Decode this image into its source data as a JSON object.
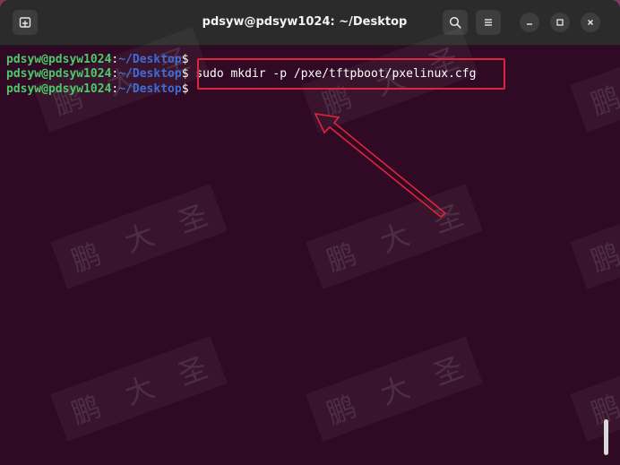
{
  "window": {
    "title": "pdsyw@pdsyw1024: ~/Desktop"
  },
  "titlebar": {
    "new_tab_icon": "new-tab-icon",
    "search_icon": "search-icon",
    "menu_icon": "hamburger-menu-icon",
    "minimize_icon": "minimize-icon",
    "maximize_icon": "maximize-icon",
    "close_icon": "close-icon"
  },
  "terminal": {
    "lines": [
      {
        "user": "pdsyw@pdsyw1024",
        "sep": ":",
        "path": "~/Desktop",
        "prompt": "$",
        "command": ""
      },
      {
        "user": "pdsyw@pdsyw1024",
        "sep": ":",
        "path": "~/Desktop",
        "prompt": "$",
        "command": " sudo mkdir -p /pxe/tftpboot/pxelinux.cfg"
      },
      {
        "user": "pdsyw@pdsyw1024",
        "sep": ":",
        "path": "~/Desktop",
        "prompt": "$",
        "command": ""
      }
    ]
  },
  "watermark": {
    "chars": [
      "鹏",
      "大",
      "圣"
    ]
  },
  "colors": {
    "terminal_bg": "#300a24",
    "user": "#4dc96a",
    "path": "#3f6dd6",
    "annotation": "#e0243c"
  }
}
